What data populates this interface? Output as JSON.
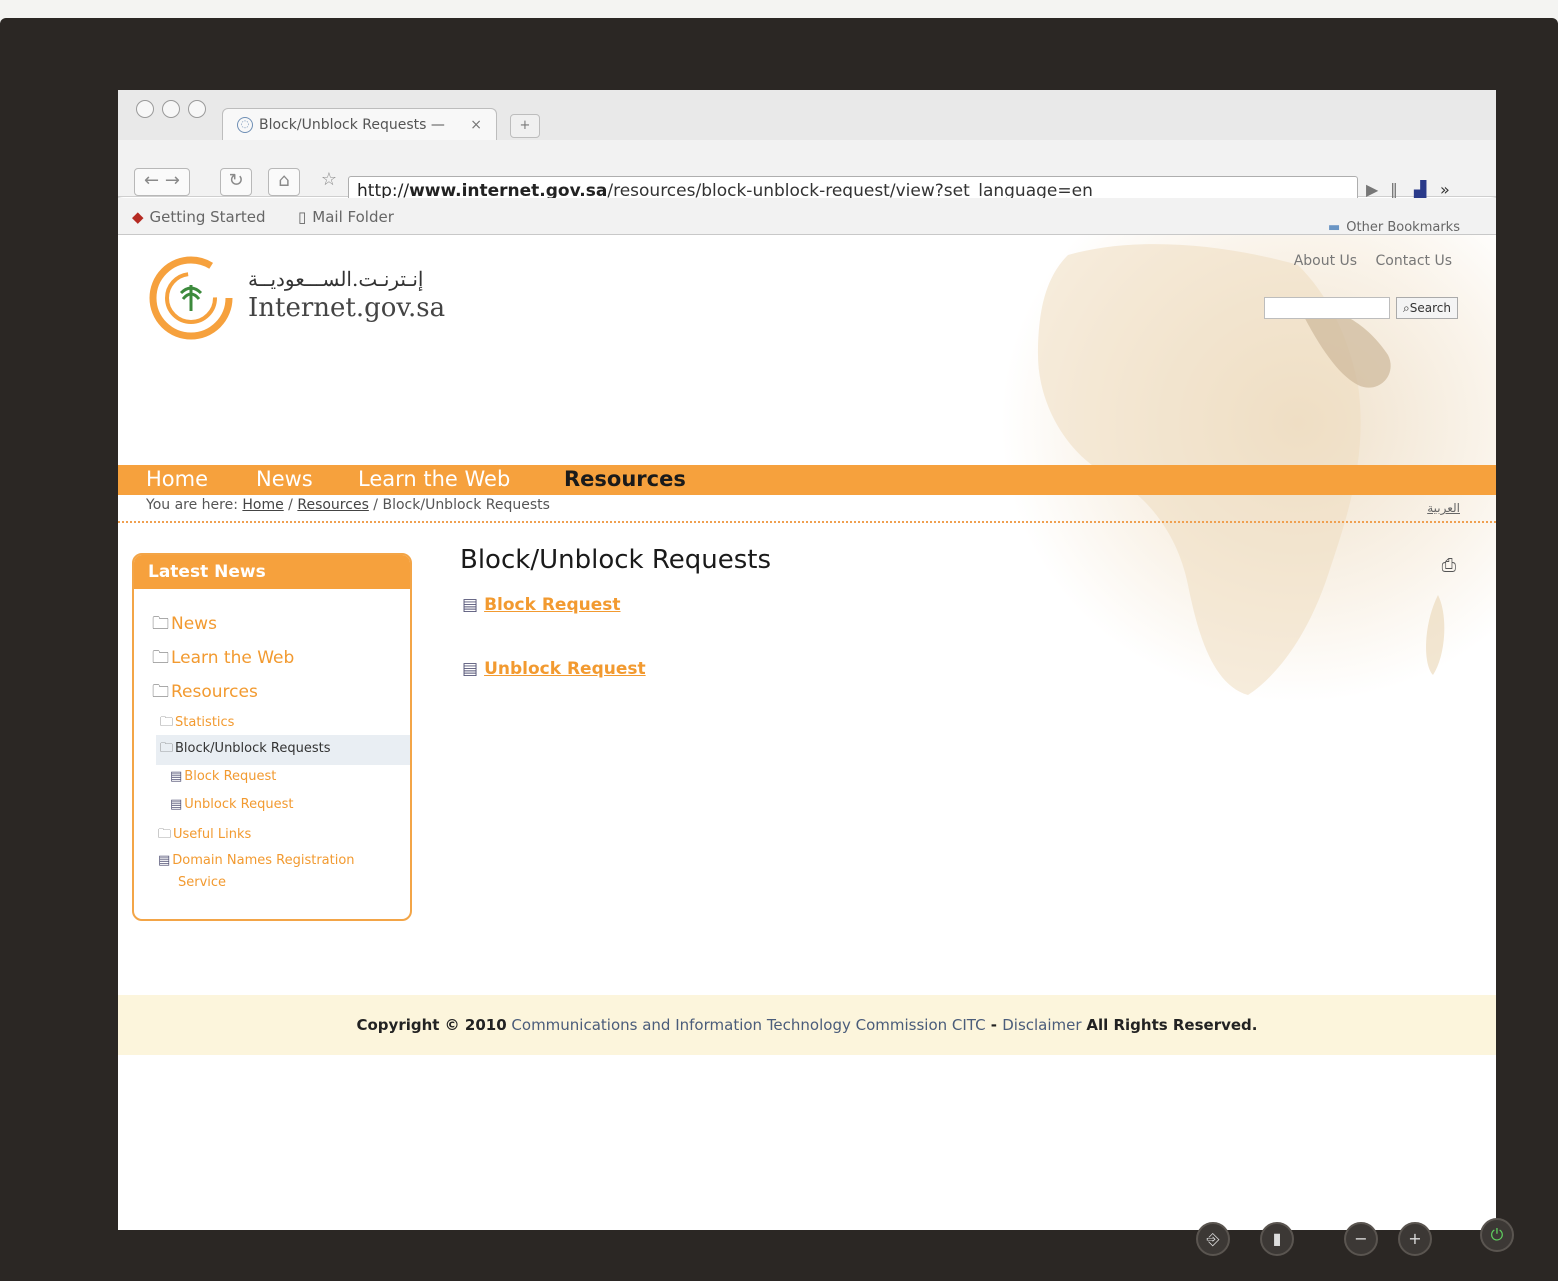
{
  "browser": {
    "tab_title": "Block/Unblock Requests — ",
    "tab_close": "×",
    "new_tab": "+",
    "url_prefix": "http://",
    "url_domain": "www.internet.gov.sa",
    "url_path": "/resources/block-unblock-request/view?set_language=en",
    "bookmarks": [
      "Getting Started",
      "Mail Folder"
    ],
    "other_bookmarks": "Other Bookmarks"
  },
  "site": {
    "logo_arabic": "إنـترنـت.الســـعوديــة",
    "logo_english": "Internet.gov.sa",
    "top_links": [
      "About Us",
      "Contact Us"
    ],
    "search_button": "Search",
    "nav": [
      "Home",
      "News",
      "Learn the Web",
      "Resources"
    ],
    "breadcrumb_label": "You are here:",
    "breadcrumb": [
      "Home",
      "Resources",
      "Block/Unblock Requests"
    ],
    "lang_link": "العربية"
  },
  "portlet": {
    "title": "Latest News",
    "items": [
      "News",
      "Learn the Web",
      "Resources",
      "Statistics",
      "Block/Unblock Requests",
      "Block Request",
      "Unblock Request",
      "Useful Links",
      "Domain Names Registration",
      "Service"
    ]
  },
  "content": {
    "title": "Block/Unblock Requests",
    "links": [
      "Block Request",
      "Unblock Request"
    ]
  },
  "footer": {
    "copyright": "Copyright © 2010",
    "org": "Communications and Information Technology Commission CITC",
    "sep": " - ",
    "disclaimer": "Disclaimer",
    "rights": "All Rights Reserved."
  },
  "icons": [
    "folder-icon",
    "document-icon",
    "print-icon",
    "back-icon",
    "forward-icon",
    "reload-icon",
    "home-icon",
    "star-icon"
  ]
}
